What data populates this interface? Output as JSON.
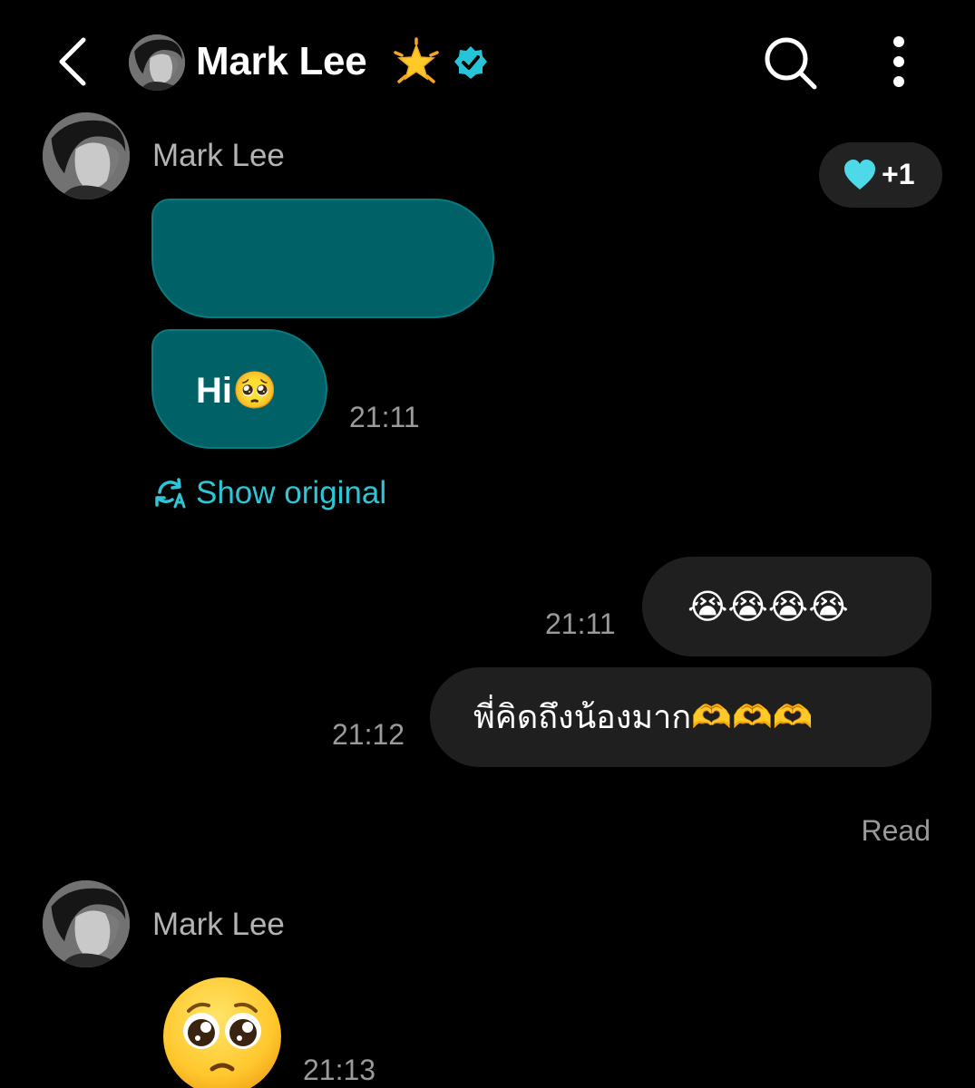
{
  "header": {
    "title": "Mark Lee",
    "back_icon": "chevron-left-icon",
    "star_icon": "glowing-star-icon",
    "verified_icon": "verified-badge-icon",
    "search_icon": "search-icon",
    "menu_icon": "more-vertical-icon"
  },
  "messages": {
    "group1": {
      "sender": "Mark Lee",
      "bubble2_text": "Hi🥺",
      "time": "21:11",
      "show_original": "Show original",
      "reaction_count": "+1",
      "reaction_icon": "heart-icon"
    },
    "out1": {
      "text": "😭😭😭😭",
      "time": "21:11"
    },
    "out2": {
      "text": "พี่คิดถึงน้องมาก🫶🫶🫶",
      "time": "21:12"
    },
    "read_status": "Read",
    "group2": {
      "sender": "Mark Lee",
      "emoji_icon": "pleading-face-icon",
      "time": "21:13"
    }
  },
  "colors": {
    "background": "#000000",
    "incoming_bubble": "#006267",
    "outgoing_bubble": "#1f1f1f",
    "accent": "#2ec6d6",
    "reaction_heart": "#4dd9e8",
    "verified_badge": "#25c4d8"
  }
}
